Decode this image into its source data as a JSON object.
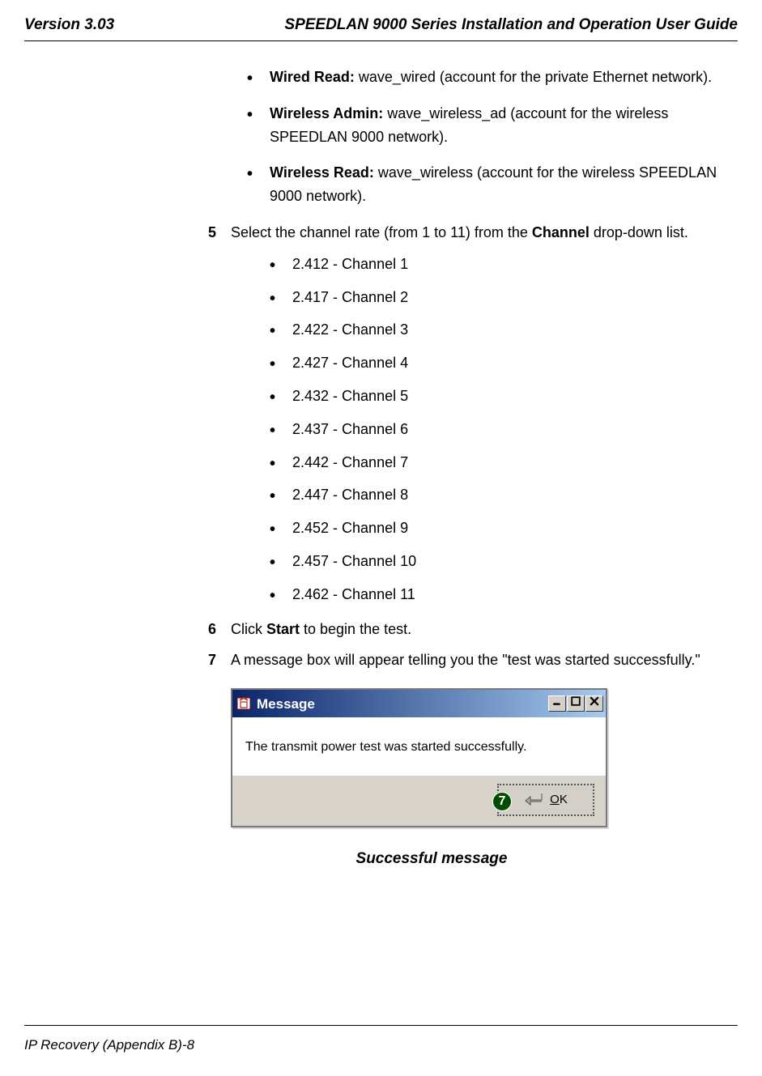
{
  "header": {
    "version": "Version 3.03",
    "title": "SPEEDLAN 9000 Series Installation and Operation User Guide"
  },
  "top_bullets": [
    {
      "label": "Wired Read:",
      "desc": " wave_wired (account for the private Ethernet network)."
    },
    {
      "label": "Wireless Admin:",
      "desc": " wave_wireless_ad (account for the wireless SPEEDLAN 9000 network)."
    },
    {
      "label": "Wireless Read:",
      "desc": " wave_wireless (account for the wireless SPEEDLAN 9000 network)."
    }
  ],
  "step5": {
    "num": "5",
    "pre": "Select the channel rate (from 1 to 11) from the ",
    "bold": "Channel",
    "post": " drop-down list."
  },
  "channels": [
    "2.412 - Channel 1",
    "2.417 - Channel 2",
    "2.422 - Channel 3",
    "2.427 - Channel 4",
    "2.432 - Channel 5",
    "2.437 - Channel 6",
    "2.442 - Channel 7",
    "2.447 - Channel 8",
    "2.452 - Channel 9",
    "2.457 - Channel 10",
    "2.462 - Channel 11"
  ],
  "step6": {
    "num": "6",
    "pre": "Click ",
    "bold": "Start",
    "post": " to begin the test."
  },
  "step7": {
    "num": "7",
    "text": "A message box will appear telling you the \"test was started successfully.\""
  },
  "dialog": {
    "title": "Message",
    "body": "The transmit power test was started successfully.",
    "ok_prefix": "O",
    "ok_suffix": "K",
    "callout": "7"
  },
  "figure_caption": "Successful message",
  "footer": "IP Recovery (Appendix B)-8"
}
